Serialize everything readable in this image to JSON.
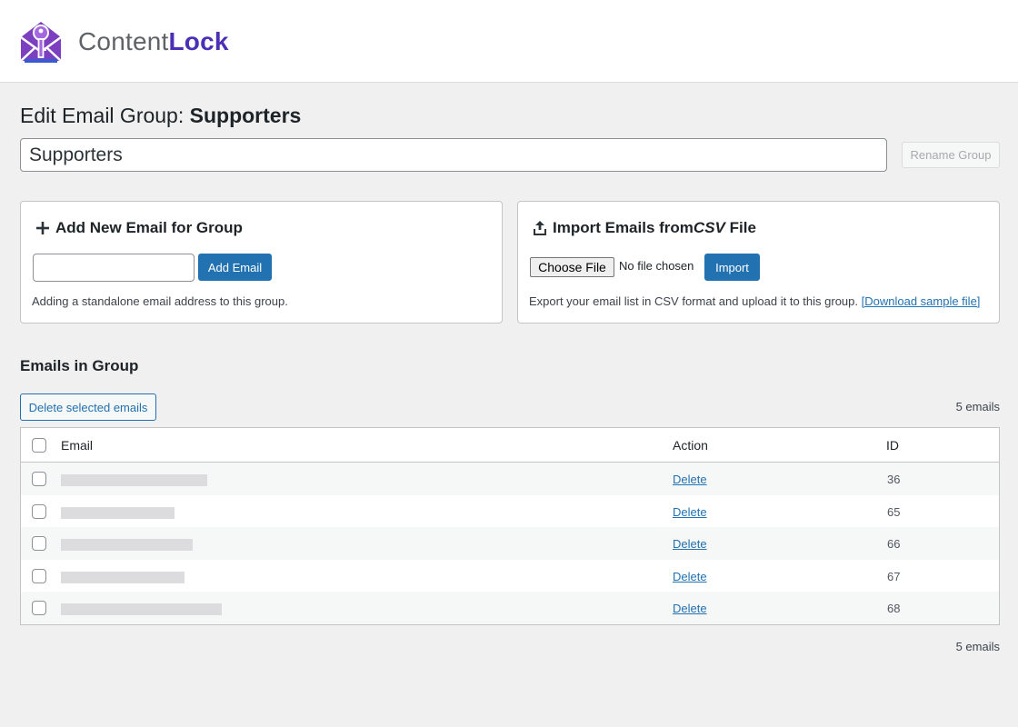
{
  "brand": {
    "name_regular": "Content",
    "name_bold": "Lock",
    "colors": {
      "purple": "#4b2fb6",
      "accent_blue": "#2271b1"
    }
  },
  "page": {
    "title_prefix": "Edit Email Group: ",
    "title_group": "Supporters",
    "group_name_value": "Supporters",
    "rename_button": "Rename Group"
  },
  "add_card": {
    "title": "Add New Email for Group",
    "icon": "plus-icon",
    "email_value": "",
    "button": "Add Email",
    "note": "Adding a standalone email address to this group."
  },
  "import_card": {
    "title_prefix": "Import Emails from ",
    "title_italic": "CSV",
    "title_suffix": " File",
    "icon": "upload-icon",
    "choose_button": "Choose File",
    "no_file": "No file chosen",
    "button": "Import",
    "note": "Export your email list in CSV format and upload it to this group. ",
    "download_link": "[Download sample file]"
  },
  "emails_section": {
    "title": "Emails in Group",
    "delete_selected": "Delete selected emails",
    "count_text": "5 emails",
    "columns": {
      "email": "Email",
      "action": "Action",
      "id": "ID"
    },
    "rows": [
      {
        "email": "",
        "action": "Delete",
        "id": "36"
      },
      {
        "email": "",
        "action": "Delete",
        "id": "65"
      },
      {
        "email": "",
        "action": "Delete",
        "id": "66"
      },
      {
        "email": "",
        "action": "Delete",
        "id": "67"
      },
      {
        "email": "",
        "action": "Delete",
        "id": "68"
      }
    ]
  }
}
